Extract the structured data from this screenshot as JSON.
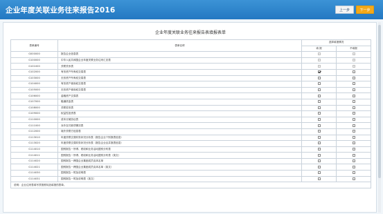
{
  "app": {
    "title": "企业年度关联业务往来报告2016",
    "prev_label": "上一步",
    "next_label": "下一步"
  },
  "doc": {
    "title": "企业年度关联业务往来报告表填报表单"
  },
  "table": {
    "col_code": "表单编号",
    "col_name": "表单名称",
    "group_header": "选择填报情况",
    "sub_fill": "填 报",
    "sub_nofill": "不填报",
    "rows": [
      {
        "code": "G000000",
        "name": "报告企业信息表",
        "fill": false,
        "nofill": false,
        "dim": true
      },
      {
        "code": "G100000",
        "name": "中华人民共和国企业年度关联业务往来汇总表",
        "fill": false,
        "nofill": false,
        "dim": true
      },
      {
        "code": "G101000",
        "name": "关联关系表",
        "fill": false,
        "nofill": false,
        "dim": true
      },
      {
        "code": "G102000",
        "name": "有形资产所有权交易表",
        "fill": true,
        "nofill": false,
        "dim": false
      },
      {
        "code": "G103000",
        "name": "无形资产所有权交易表",
        "fill": false,
        "nofill": false,
        "dim": false
      },
      {
        "code": "G104000",
        "name": "有形资产使用权交易表",
        "fill": false,
        "nofill": false,
        "dim": false
      },
      {
        "code": "G105000",
        "name": "无形资产使用权交易表",
        "fill": false,
        "nofill": false,
        "dim": false
      },
      {
        "code": "G106000",
        "name": "金融资产交易表",
        "fill": false,
        "nofill": false,
        "dim": false
      },
      {
        "code": "G107000",
        "name": "融通资金表",
        "fill": false,
        "nofill": false,
        "dim": false
      },
      {
        "code": "G108000",
        "name": "关联劳务表",
        "fill": false,
        "nofill": false,
        "dim": false
      },
      {
        "code": "G109000",
        "name": "权益性投资表",
        "fill": false,
        "nofill": false,
        "dim": false
      },
      {
        "code": "G110000",
        "name": "成本分摊协议表",
        "fill": false,
        "nofill": false,
        "dim": false
      },
      {
        "code": "G111000",
        "name": "对外支付款项情况表",
        "fill": false,
        "nofill": false,
        "dim": false
      },
      {
        "code": "G112000",
        "name": "境外关联方信息表",
        "fill": false,
        "nofill": false,
        "dim": false
      },
      {
        "code": "G113010",
        "name": "年度关联交易财务状况分析表（报告企业个别报表信息）",
        "fill": false,
        "nofill": false,
        "dim": false
      },
      {
        "code": "G113020",
        "name": "年度关联交易财务状况分析表（报告企业合并报表信息）",
        "fill": false,
        "nofill": false,
        "dim": false
      },
      {
        "code": "G114010",
        "name": "国别报告－所得、税收和业务活动国别分布表",
        "fill": false,
        "nofill": false,
        "dim": false
      },
      {
        "code": "G114011",
        "name": "国别报告－所得、税收和业务活动国别分布表（英文）",
        "fill": false,
        "nofill": false,
        "dim": false
      },
      {
        "code": "G114020",
        "name": "国别报告－跨国企业集团成员实体名单",
        "fill": false,
        "nofill": false,
        "dim": false
      },
      {
        "code": "G114021",
        "name": "国别报告－跨国企业集团成员实体名单（英文）",
        "fill": false,
        "nofill": false,
        "dim": false
      },
      {
        "code": "G114030",
        "name": "国别报告－附加说明表",
        "fill": false,
        "nofill": false,
        "dim": false
      },
      {
        "code": "G114031",
        "name": "国别报告－附加说明表（英文）",
        "fill": false,
        "nofill": false,
        "dim": false
      }
    ],
    "note": "说明：企业往来表填写须按照勾选填报的表单。"
  }
}
